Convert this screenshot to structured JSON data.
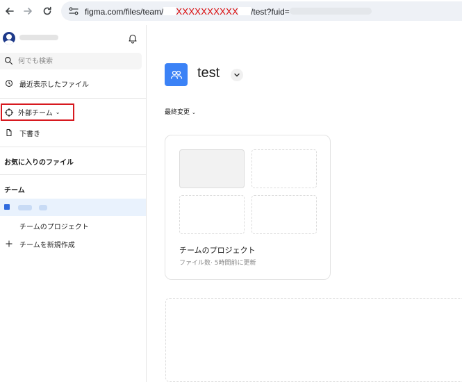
{
  "browser": {
    "url_prefix": "figma.com/files/team/",
    "url_masked": "XXXXXXXXXX",
    "url_suffix": "/test?fuid="
  },
  "sidebar": {
    "search": {
      "placeholder": "何でも検索"
    },
    "recent_label": "最近表示したファイル",
    "external_team": {
      "label": "外部チーム",
      "chevron": "⌄"
    },
    "drafts_label": "下書き",
    "favorites_title": "お気に入りのファイル",
    "teams_title": "チーム",
    "team_project_label": "チームのプロジェクト",
    "new_team_label": "チームを新規作成"
  },
  "main": {
    "team_title": "test",
    "sort_label": "最終変更",
    "sort_chevron": "⌄",
    "project_card": {
      "title": "チームのプロジェクト",
      "meta": "ファイル数· 5時間前に更新"
    }
  },
  "colors": {
    "accent": "#3b82f6",
    "highlight_border": "#d7191f",
    "selected_bg": "#e9f2fd",
    "masked_text": "#d90000"
  }
}
